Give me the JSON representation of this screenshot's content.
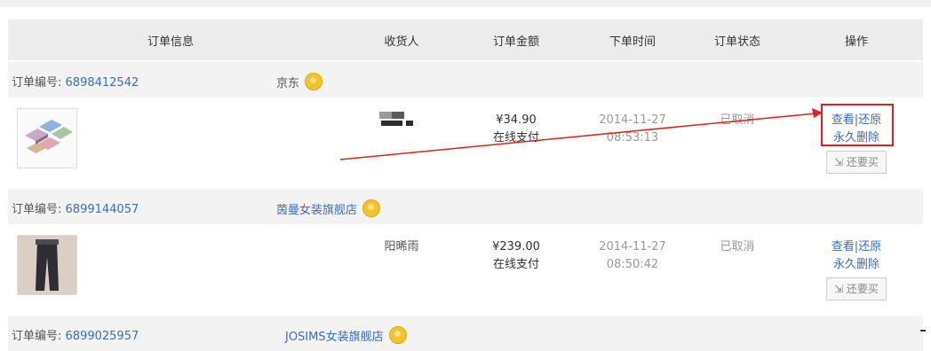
{
  "header": {
    "order_info": "订单信息",
    "receiver": "收货人",
    "amount": "订单金额",
    "order_time": "下单时间",
    "status": "订单状态",
    "operation": "操作"
  },
  "orders": [
    {
      "label": "订单编号:",
      "number": "6898412542",
      "shop": "京东",
      "receiver": "",
      "amount": "¥34.90",
      "pay": "在线支付",
      "date": "2014-11-27",
      "time": "08:53:13",
      "status": "已取消",
      "view": "查看",
      "restore": "还原",
      "delete": "永久删除",
      "rebuy": "还要买",
      "product": "folded-cloth-boxes"
    },
    {
      "label": "订单编号:",
      "number": "6899144057",
      "shop": "茵曼女装旗舰店",
      "receiver": "阳晞雨",
      "amount": "¥239.00",
      "pay": "在线支付",
      "date": "2014-11-27",
      "time": "08:50:42",
      "status": "已取消",
      "view": "查看",
      "restore": "还原",
      "delete": "永久删除",
      "rebuy": "还要买",
      "product": "pants"
    },
    {
      "label": "订单编号:",
      "number": "6899025957",
      "shop": "JOSIMS女装旗舰店"
    }
  ],
  "colors": {
    "link": "#3a6fb6",
    "highlight": "#e02020",
    "header_bg": "#ececec",
    "row_bg": "#f3f3f3"
  }
}
